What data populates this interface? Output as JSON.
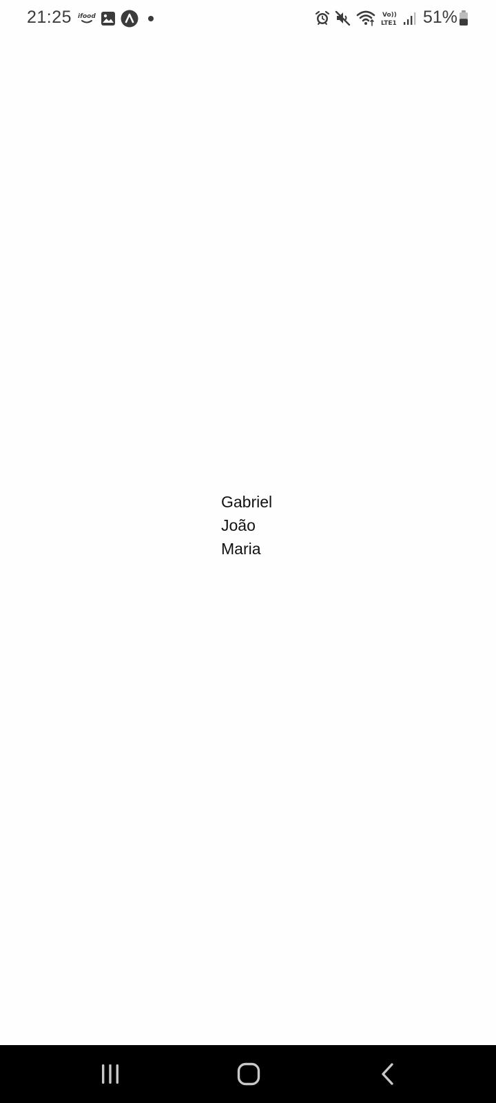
{
  "status_bar": {
    "time": "21:25",
    "notification_icons": [
      "ifood-icon",
      "gallery-icon",
      "app-a-icon",
      "dot-icon"
    ],
    "ifood_label": "ifood",
    "system_icons": [
      "alarm-icon",
      "mute-icon",
      "wifi-icon",
      "volte-icon",
      "signal-icon",
      "battery-icon"
    ],
    "volte_line1": "Vo))",
    "volte_line2": "LTE1",
    "battery_percent": "51%",
    "battery_level": 0.51
  },
  "main": {
    "names": [
      "Gabriel",
      "João",
      "Maria"
    ]
  },
  "nav_bar": {
    "buttons": [
      "recents-button",
      "home-button",
      "back-button"
    ]
  },
  "colors": {
    "background": "#fefefe",
    "status_text": "#3b3b3b",
    "content_text": "#111111",
    "nav_background": "#000000",
    "nav_icons": "#c8c8c8"
  }
}
